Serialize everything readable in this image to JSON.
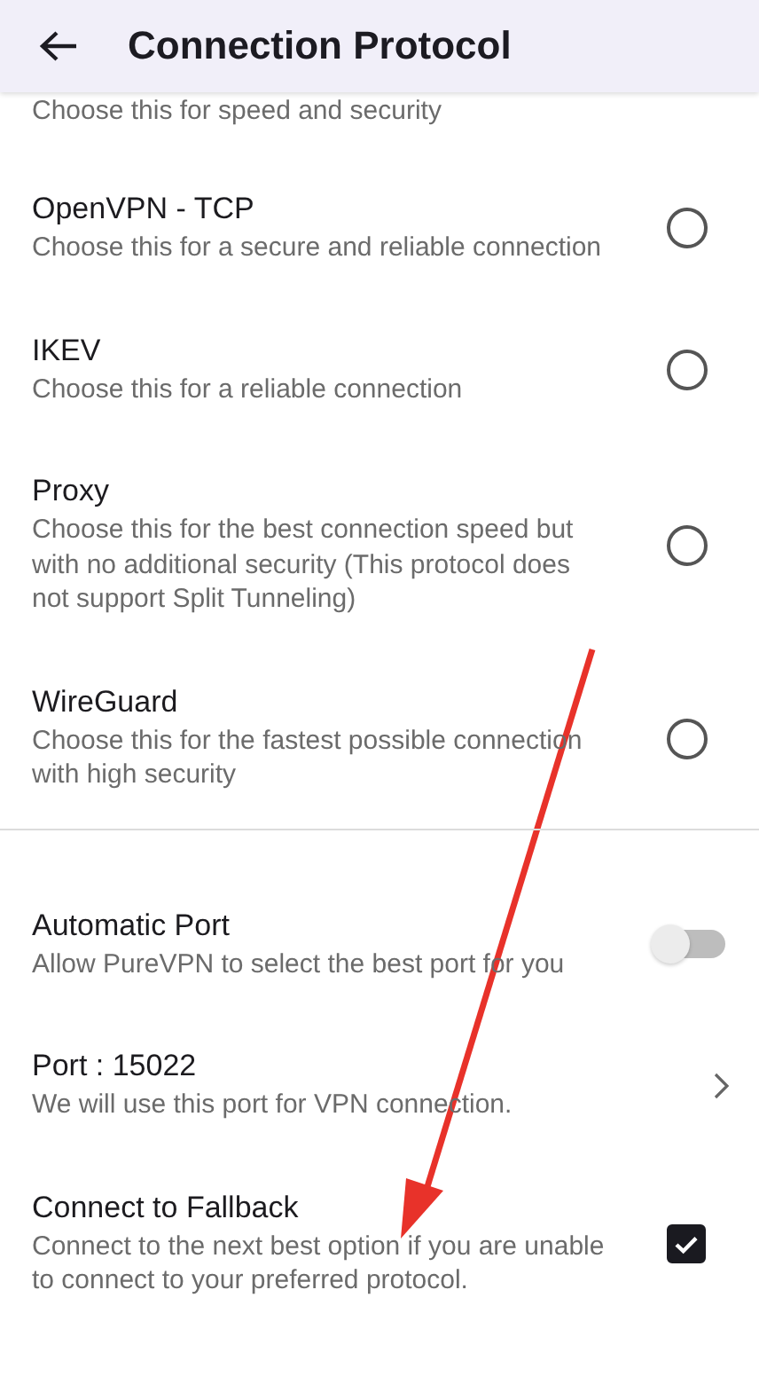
{
  "header": {
    "title": "Connection Protocol"
  },
  "partial_description": "Choose this for speed and security",
  "protocols": [
    {
      "name": "OpenVPN - TCP",
      "description": "Choose this for a secure and reliable connection",
      "selected": false
    },
    {
      "name": "IKEV",
      "description": "Choose this for a reliable connection",
      "selected": false
    },
    {
      "name": "Proxy",
      "description": "Choose this for the best connection speed but with no additional security (This protocol does not support Split Tunneling)",
      "selected": false
    },
    {
      "name": "WireGuard",
      "description": "Choose this for the fastest possible connection with high security",
      "selected": false
    }
  ],
  "settings": [
    {
      "kind": "toggle",
      "title": "Automatic Port",
      "description": "Allow PureVPN to select the best port for you",
      "on": false
    },
    {
      "kind": "link",
      "title": "Port : 15022",
      "description": "We will use this port for VPN connection."
    },
    {
      "kind": "checkbox",
      "title": "Connect to Fallback",
      "description": "Connect to the next best option if you are unable to connect to your preferred protocol.",
      "checked": true
    }
  ],
  "annotations": [
    {
      "kind": "arrow",
      "color": "#e8322a"
    }
  ]
}
